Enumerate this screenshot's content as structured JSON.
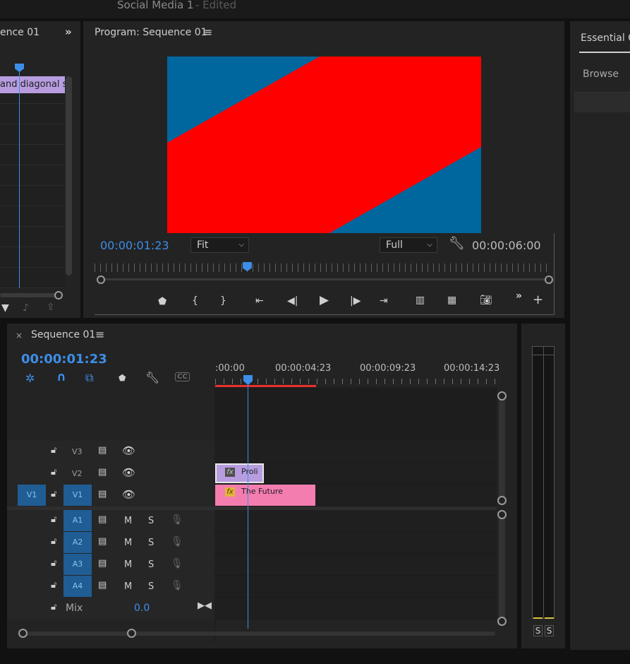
{
  "app": {
    "project_title": "Social Media 1",
    "edited_label": "- Edited"
  },
  "source_panel": {
    "tab_label": "ence 01",
    "clip_label": "and diagonal sp"
  },
  "program_monitor": {
    "title": "Program: Sequence 01",
    "current_time": "00:00:01:23",
    "duration": "00:00:06:00",
    "zoom_select": "Fit",
    "quality_select": "Full",
    "playhead_fraction": 0.33,
    "colors": {
      "red": "#ff0000",
      "blue": "#00679e"
    }
  },
  "right_panel": {
    "tab_label": "Essential Gr",
    "browse_label": "Browse"
  },
  "timeline": {
    "tab_label": "Sequence 01",
    "current_time": "00:00:01:23",
    "ruler_labels": [
      ":00:00",
      "00:00:04:23",
      "00:00:09:23",
      "00:00:14:23"
    ],
    "video_tracks": [
      {
        "name": "V3"
      },
      {
        "name": "V2",
        "clip": "Proli",
        "fx": "fx"
      },
      {
        "name": "V1",
        "clip": "The Future",
        "fx": "fx",
        "source": "V1"
      }
    ],
    "audio_tracks": [
      {
        "name": "A1",
        "m": "M",
        "s": "S"
      },
      {
        "name": "A2",
        "m": "M",
        "s": "S"
      },
      {
        "name": "A3",
        "m": "M",
        "s": "S"
      },
      {
        "name": "A4",
        "m": "M",
        "s": "S"
      }
    ],
    "mix_label": "Mix",
    "mix_value": "0.0"
  },
  "meter": {
    "solo_left": "S",
    "solo_right": "S"
  }
}
